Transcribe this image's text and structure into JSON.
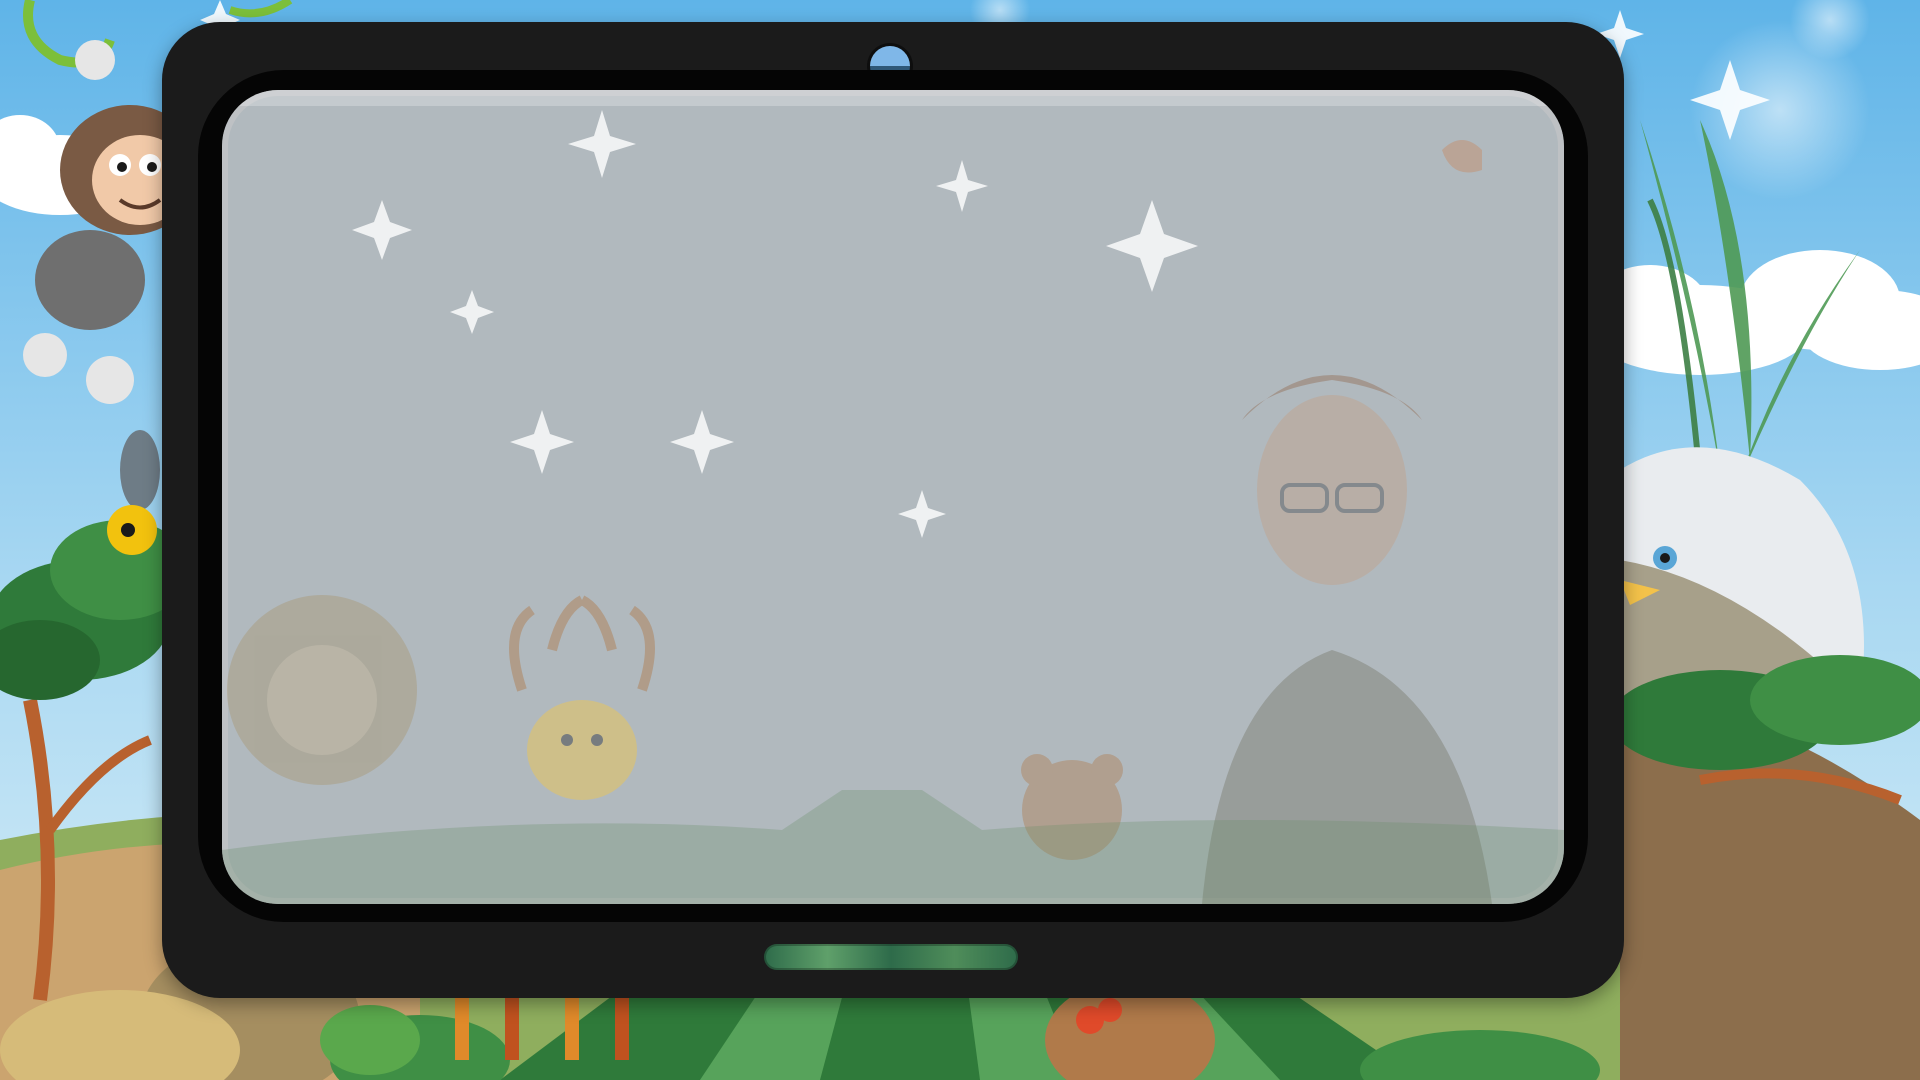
{
  "scene": {
    "description_icons": [
      "monkey-icon",
      "toucan-icon",
      "lion-icon",
      "deer-icon",
      "bear-icon",
      "eagle-icon",
      "explorer-woman-figure",
      "sparkle-icon",
      "cloud-icon",
      "palm-leaf-icon"
    ],
    "colors": {
      "sky": "#7fc3ec",
      "tablet_body": "#1b1b1b",
      "bezel": "#050505",
      "screen_overlay": "#e2ecf2",
      "grass": "#3e8a45",
      "camera_top": "#7fb7e8"
    }
  }
}
